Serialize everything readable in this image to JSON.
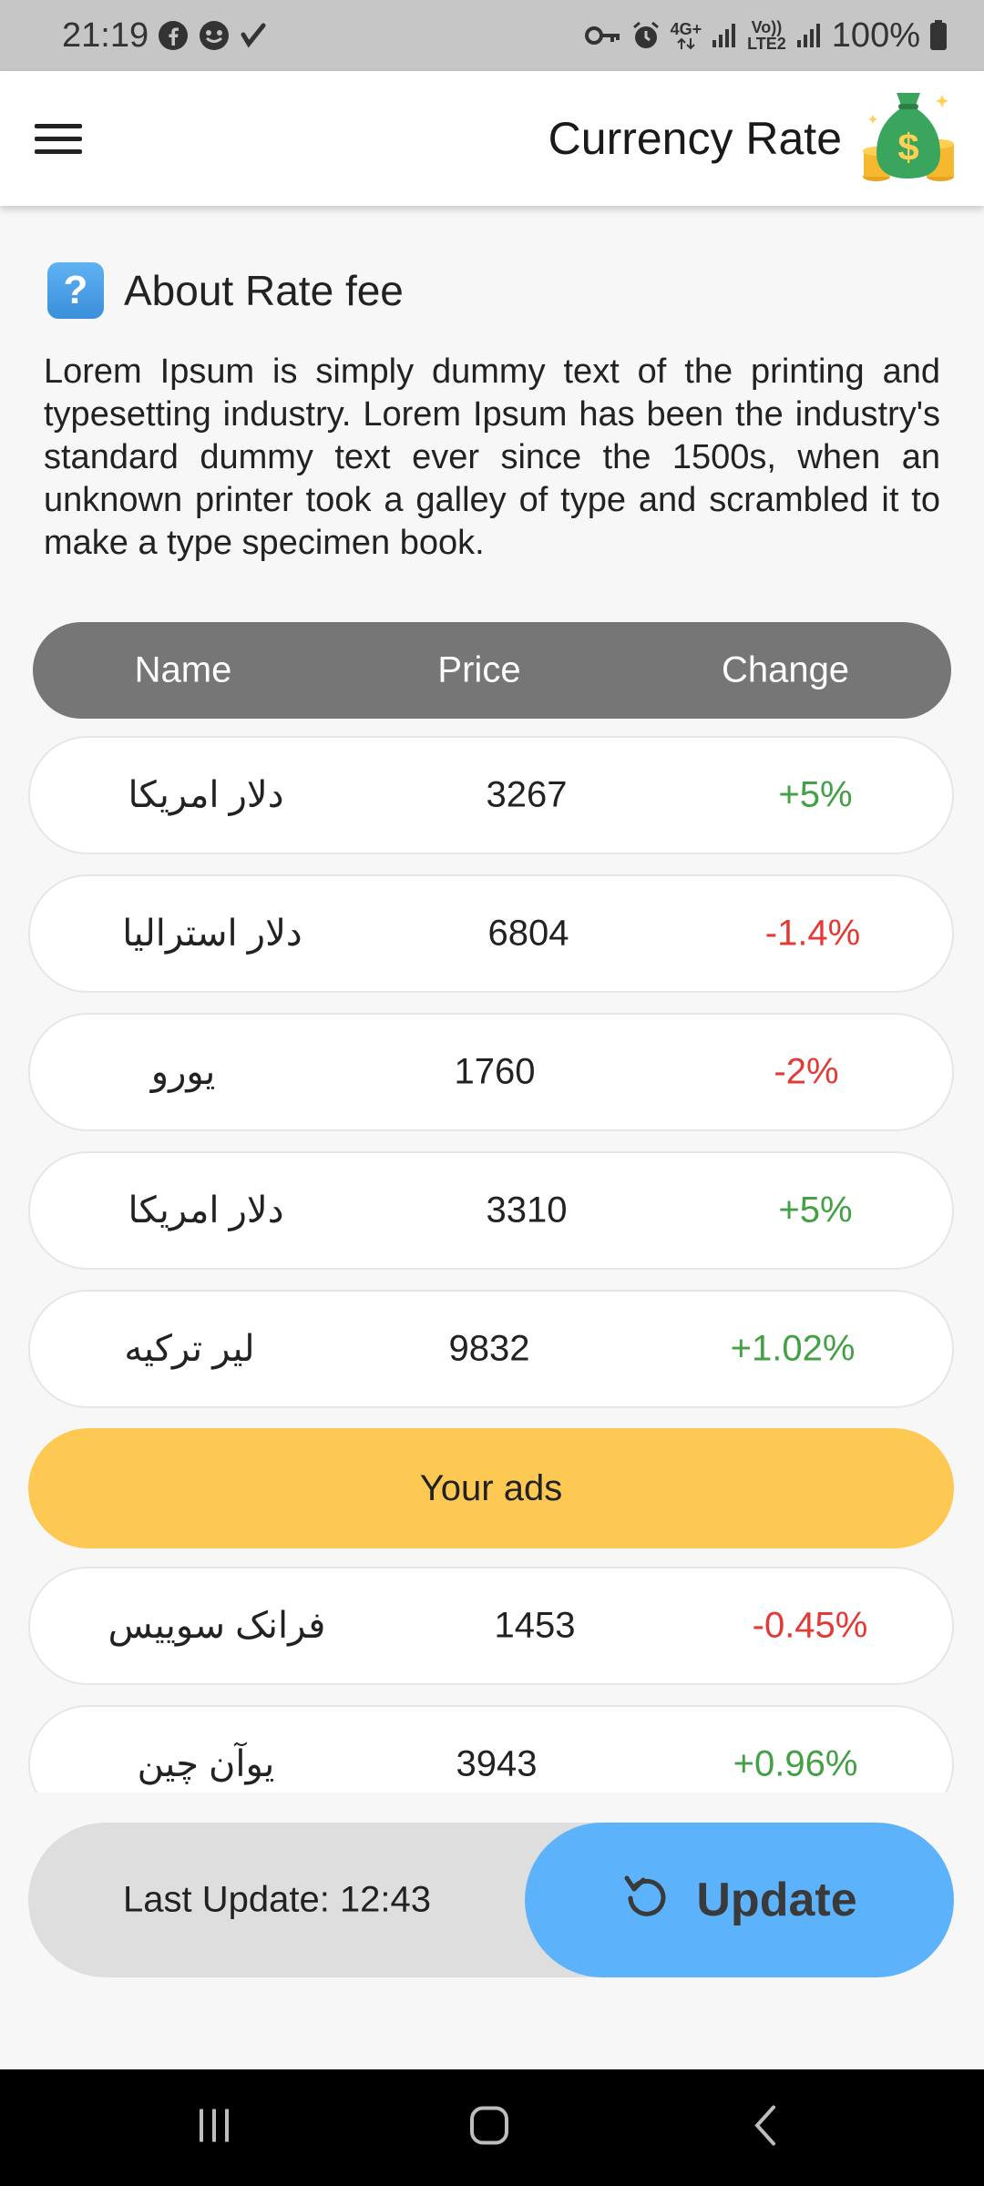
{
  "status_bar": {
    "time": "21:19",
    "battery_percent": "100%",
    "net_label_top": "4G+",
    "volte_label_top": "Vo))",
    "volte_label_bottom": "LTE2",
    "icons": [
      "facebook-icon",
      "messenger-icon",
      "check-icon",
      "key-icon",
      "alarm-icon",
      "data-arrows-icon",
      "signal-icon",
      "signal-icon-2",
      "battery-icon"
    ]
  },
  "app_bar": {
    "title": "Currency Rate",
    "logo_symbol": "$",
    "icons": [
      "menu-icon",
      "money-bag-icon"
    ]
  },
  "about": {
    "title": "About Rate fee",
    "icon_symbol": "?",
    "text": "Lorem Ipsum is simply dummy text of the printing and typesetting industry. Lorem Ipsum has been the industry's standard dummy text ever since the 1500s, when an unknown printer took a galley of type and scrambled it to make a type specimen book."
  },
  "table": {
    "headers": {
      "name": "Name",
      "price": "Price",
      "change": "Change"
    },
    "rows": [
      {
        "name": "دلار امریکا",
        "price": "3267",
        "change": "+5%",
        "trend": "up"
      },
      {
        "name": "دلار استرالیا",
        "price": "6804",
        "change": "-1.4%",
        "trend": "down"
      },
      {
        "name": "یورو",
        "price": "1760",
        "change": "-2%",
        "trend": "down"
      },
      {
        "name": "دلار امریکا",
        "price": "3310",
        "change": "+5%",
        "trend": "up"
      },
      {
        "name": "لیر ترکیه",
        "price": "9832",
        "change": "+1.02%",
        "trend": "up"
      }
    ],
    "ad_label": "Your ads",
    "rows_after_ad": [
      {
        "name": "فرانک سوییس",
        "price": "1453",
        "change": "-0.45%",
        "trend": "down"
      },
      {
        "name": "یوآن چین",
        "price": "3943",
        "change": "+0.96%",
        "trend": "up"
      }
    ]
  },
  "footer": {
    "last_update": "Last Update: 12:43",
    "update_button": "Update",
    "icons": [
      "refresh-icon"
    ]
  },
  "nav_bar": {
    "icons": [
      "recent-apps-icon",
      "home-icon",
      "back-icon"
    ]
  },
  "colors": {
    "positive": "#43a047",
    "negative": "#e53935",
    "header_pill": "#767676",
    "ad_pill": "#fec953",
    "update_button": "#5db3fb"
  }
}
